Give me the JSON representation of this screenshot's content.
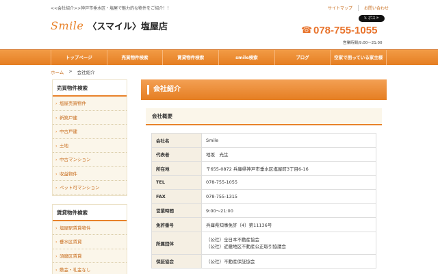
{
  "header": {
    "tagline": "<<会社紹介>>神戸市垂水区・塩屋で魅力的な物件をご紹介！！",
    "logo_mark": "Smile",
    "shop_name": "〈スマイル〉塩屋店",
    "top_links": [
      "サイトマップ",
      "お問い合わせ"
    ],
    "x_post": "ポスト",
    "phone": "078-755-1055",
    "hours": "営業時間/9:00〜21:00"
  },
  "nav": {
    "items": [
      "トップページ",
      "売買物件検索",
      "賃貸物件検索",
      "smile検索",
      "ブログ",
      "空家で困っている家主様"
    ]
  },
  "breadcrumb": {
    "home": "ホーム",
    "separator": ">",
    "current": "会社紹介"
  },
  "sidebar": {
    "sale_title": "売買物件検索",
    "sale_items": [
      "塩屋売買物件",
      "新築戸建",
      "中古戸建",
      "土地",
      "中古マンション",
      "収益物件",
      "ペット可マンション"
    ],
    "rent_title": "賃貸物件検索",
    "rent_items": [
      "塩屋駅賃貸物件",
      "垂水区賃貸",
      "須磨区賃貸",
      "敷金・礼金なし"
    ]
  },
  "main": {
    "page_title": "会社紹介",
    "section_title": "会社概要",
    "rows": [
      {
        "label": "会社名",
        "value": "Smile"
      },
      {
        "label": "代表者",
        "value": "地坂　光生"
      },
      {
        "label": "所在地",
        "value": "〒655-0872 兵庫県神戸市垂水区塩屋町3丁目6-16"
      },
      {
        "label": "TEL",
        "value": "078-755-1055"
      },
      {
        "label": "FAX",
        "value": "078-755-1315"
      },
      {
        "label": "営業時間",
        "value": "9:00〜21:00"
      },
      {
        "label": "免許番号",
        "value": "兵庫県知事免許（4）第11136号"
      },
      {
        "label": "所属団体",
        "value_lines": [
          "（公社）全日本不動産協会",
          "（公社）近畿地区不動産公正取引協議会"
        ]
      },
      {
        "label": "保証協会",
        "value": "（公社）不動産保証協会"
      }
    ]
  },
  "colors": {
    "accent": "#e8822a",
    "link": "#c76b1a",
    "sidebar_bg": "#fbf6ea"
  }
}
